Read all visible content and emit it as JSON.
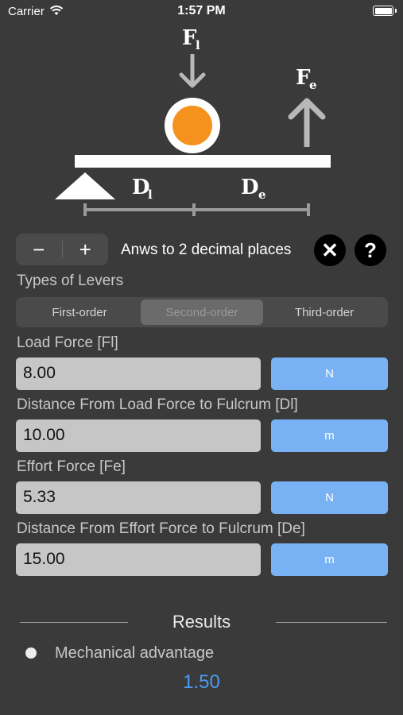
{
  "status_bar": {
    "carrier": "Carrier",
    "time": "1:57 PM"
  },
  "diagram": {
    "load_force_label": "F",
    "load_force_sub": "l",
    "effort_force_label": "F",
    "effort_force_sub": "e",
    "load_distance_label": "D",
    "load_distance_sub": "l",
    "effort_distance_label": "D",
    "effort_distance_sub": "e",
    "load_color": "#f5921e"
  },
  "controls": {
    "decrement_label": "−",
    "increment_label": "+",
    "decimals_text": "Anws to 2 decimal places",
    "clear_icon": "✕",
    "help_icon": "?"
  },
  "lever_types": {
    "label": "Types of Levers",
    "options": [
      "First-order",
      "Second-order",
      "Third-order"
    ],
    "selected": "Second-order"
  },
  "inputs": [
    {
      "label": "Load Force [Fl]",
      "value": "8.00",
      "unit": "N"
    },
    {
      "label": "Distance From Load Force to Fulcrum [Dl]",
      "value": "10.00",
      "unit": "m"
    },
    {
      "label": "Effort Force [Fe]",
      "value": "5.33",
      "unit": "N"
    },
    {
      "label": "Distance From Effort Force to Fulcrum [De]",
      "value": "15.00",
      "unit": "m"
    }
  ],
  "results": {
    "title": "Results",
    "items": [
      {
        "label": "Mechanical advantage",
        "value": "1.50"
      }
    ]
  },
  "colors": {
    "background": "#3a3a3a",
    "accent": "#78b2f5",
    "result_value": "#4a9bf0"
  }
}
